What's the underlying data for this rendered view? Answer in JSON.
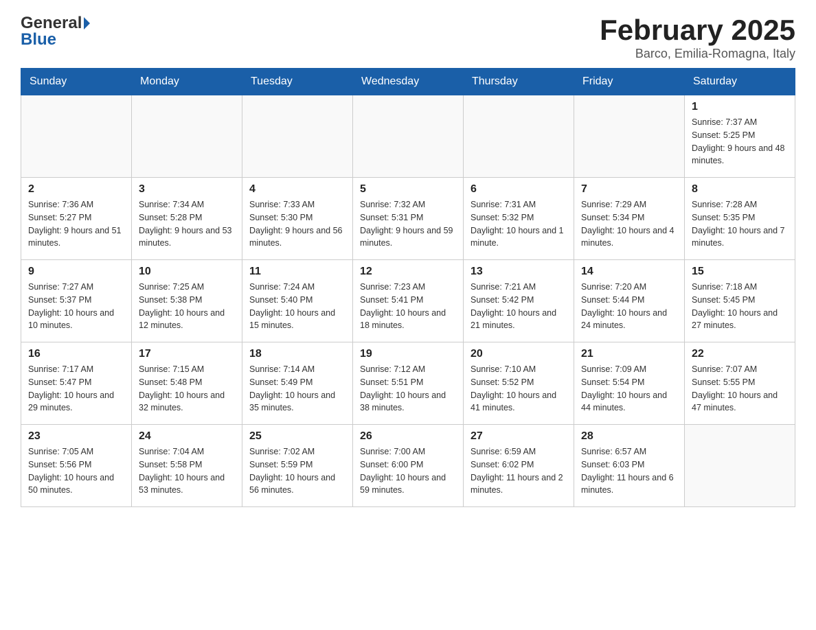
{
  "logo": {
    "line1": "General",
    "line2": "Blue"
  },
  "title": "February 2025",
  "subtitle": "Barco, Emilia-Romagna, Italy",
  "weekdays": [
    "Sunday",
    "Monday",
    "Tuesday",
    "Wednesday",
    "Thursday",
    "Friday",
    "Saturday"
  ],
  "weeks": [
    [
      {
        "day": "",
        "info": ""
      },
      {
        "day": "",
        "info": ""
      },
      {
        "day": "",
        "info": ""
      },
      {
        "day": "",
        "info": ""
      },
      {
        "day": "",
        "info": ""
      },
      {
        "day": "",
        "info": ""
      },
      {
        "day": "1",
        "info": "Sunrise: 7:37 AM\nSunset: 5:25 PM\nDaylight: 9 hours and 48 minutes."
      }
    ],
    [
      {
        "day": "2",
        "info": "Sunrise: 7:36 AM\nSunset: 5:27 PM\nDaylight: 9 hours and 51 minutes."
      },
      {
        "day": "3",
        "info": "Sunrise: 7:34 AM\nSunset: 5:28 PM\nDaylight: 9 hours and 53 minutes."
      },
      {
        "day": "4",
        "info": "Sunrise: 7:33 AM\nSunset: 5:30 PM\nDaylight: 9 hours and 56 minutes."
      },
      {
        "day": "5",
        "info": "Sunrise: 7:32 AM\nSunset: 5:31 PM\nDaylight: 9 hours and 59 minutes."
      },
      {
        "day": "6",
        "info": "Sunrise: 7:31 AM\nSunset: 5:32 PM\nDaylight: 10 hours and 1 minute."
      },
      {
        "day": "7",
        "info": "Sunrise: 7:29 AM\nSunset: 5:34 PM\nDaylight: 10 hours and 4 minutes."
      },
      {
        "day": "8",
        "info": "Sunrise: 7:28 AM\nSunset: 5:35 PM\nDaylight: 10 hours and 7 minutes."
      }
    ],
    [
      {
        "day": "9",
        "info": "Sunrise: 7:27 AM\nSunset: 5:37 PM\nDaylight: 10 hours and 10 minutes."
      },
      {
        "day": "10",
        "info": "Sunrise: 7:25 AM\nSunset: 5:38 PM\nDaylight: 10 hours and 12 minutes."
      },
      {
        "day": "11",
        "info": "Sunrise: 7:24 AM\nSunset: 5:40 PM\nDaylight: 10 hours and 15 minutes."
      },
      {
        "day": "12",
        "info": "Sunrise: 7:23 AM\nSunset: 5:41 PM\nDaylight: 10 hours and 18 minutes."
      },
      {
        "day": "13",
        "info": "Sunrise: 7:21 AM\nSunset: 5:42 PM\nDaylight: 10 hours and 21 minutes."
      },
      {
        "day": "14",
        "info": "Sunrise: 7:20 AM\nSunset: 5:44 PM\nDaylight: 10 hours and 24 minutes."
      },
      {
        "day": "15",
        "info": "Sunrise: 7:18 AM\nSunset: 5:45 PM\nDaylight: 10 hours and 27 minutes."
      }
    ],
    [
      {
        "day": "16",
        "info": "Sunrise: 7:17 AM\nSunset: 5:47 PM\nDaylight: 10 hours and 29 minutes."
      },
      {
        "day": "17",
        "info": "Sunrise: 7:15 AM\nSunset: 5:48 PM\nDaylight: 10 hours and 32 minutes."
      },
      {
        "day": "18",
        "info": "Sunrise: 7:14 AM\nSunset: 5:49 PM\nDaylight: 10 hours and 35 minutes."
      },
      {
        "day": "19",
        "info": "Sunrise: 7:12 AM\nSunset: 5:51 PM\nDaylight: 10 hours and 38 minutes."
      },
      {
        "day": "20",
        "info": "Sunrise: 7:10 AM\nSunset: 5:52 PM\nDaylight: 10 hours and 41 minutes."
      },
      {
        "day": "21",
        "info": "Sunrise: 7:09 AM\nSunset: 5:54 PM\nDaylight: 10 hours and 44 minutes."
      },
      {
        "day": "22",
        "info": "Sunrise: 7:07 AM\nSunset: 5:55 PM\nDaylight: 10 hours and 47 minutes."
      }
    ],
    [
      {
        "day": "23",
        "info": "Sunrise: 7:05 AM\nSunset: 5:56 PM\nDaylight: 10 hours and 50 minutes."
      },
      {
        "day": "24",
        "info": "Sunrise: 7:04 AM\nSunset: 5:58 PM\nDaylight: 10 hours and 53 minutes."
      },
      {
        "day": "25",
        "info": "Sunrise: 7:02 AM\nSunset: 5:59 PM\nDaylight: 10 hours and 56 minutes."
      },
      {
        "day": "26",
        "info": "Sunrise: 7:00 AM\nSunset: 6:00 PM\nDaylight: 10 hours and 59 minutes."
      },
      {
        "day": "27",
        "info": "Sunrise: 6:59 AM\nSunset: 6:02 PM\nDaylight: 11 hours and 2 minutes."
      },
      {
        "day": "28",
        "info": "Sunrise: 6:57 AM\nSunset: 6:03 PM\nDaylight: 11 hours and 6 minutes."
      },
      {
        "day": "",
        "info": ""
      }
    ]
  ]
}
